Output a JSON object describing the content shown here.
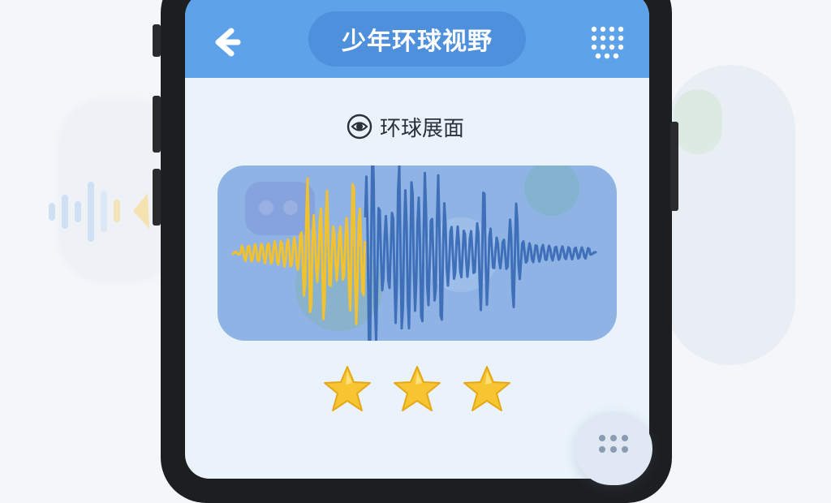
{
  "header": {
    "title": "少年环球视野",
    "back_icon": "back-arrow-icon",
    "menu_icon": "grid-dots-icon"
  },
  "section": {
    "title": "环球展面",
    "icon": "eye-icon"
  },
  "audio_card": {
    "icon": "sound-wave-icon",
    "colors": {
      "played": "#f2c12e",
      "unplayed": "#3f6fb8",
      "card": "#8fb3e4"
    }
  },
  "rating": {
    "stars": 3,
    "max": 3,
    "color": "#f7c531"
  },
  "keypad": {
    "icon": "keypad-dots-icon"
  },
  "colors": {
    "header": "#5ea2ea",
    "title_pill": "#4e90db",
    "screen": "#eaf3fb"
  }
}
